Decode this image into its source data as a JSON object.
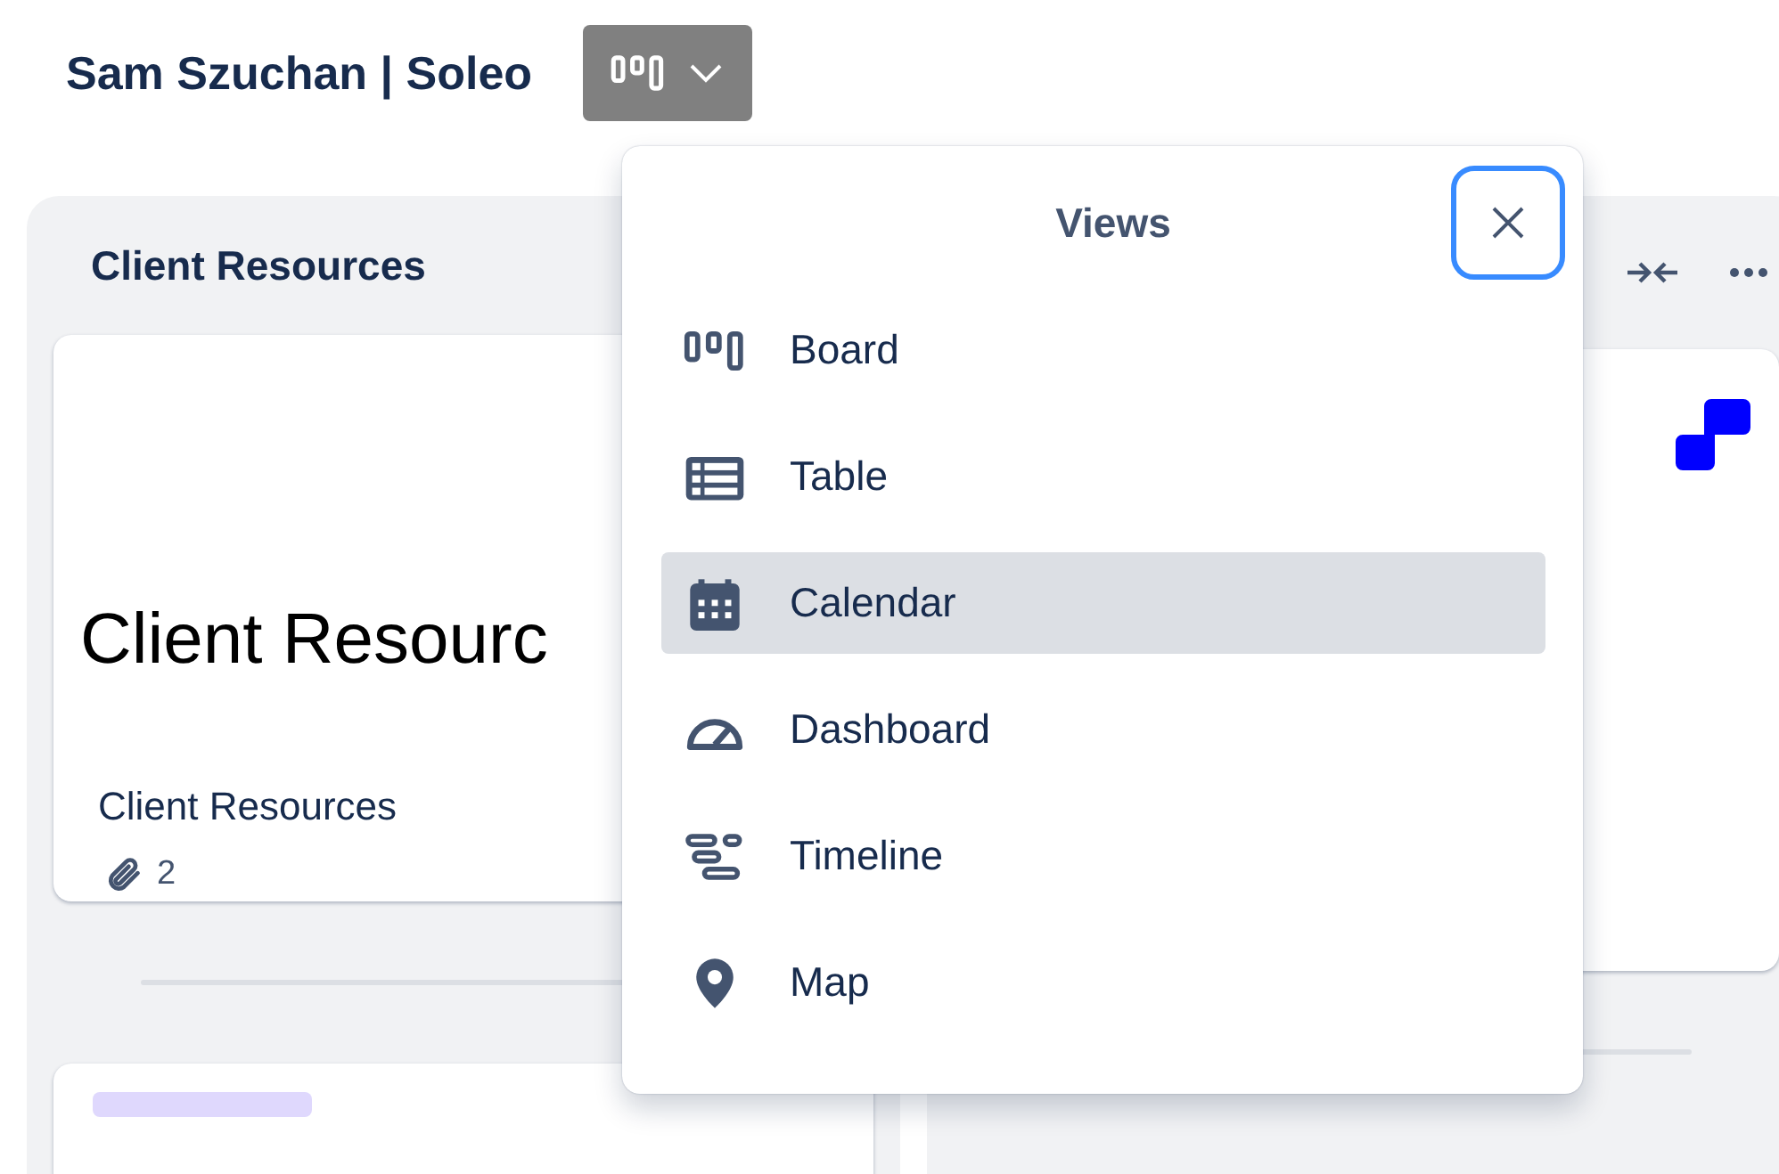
{
  "header": {
    "title": "Sam Szuchan | Soleo"
  },
  "lists": [
    {
      "title": "Client Resources",
      "cards": [
        {
          "kind": "cover",
          "cover_text": "Client Resourc",
          "title": "Client Resources",
          "attachments": "2"
        },
        {
          "kind": "label"
        }
      ]
    },
    {
      "cards": [
        {
          "kind": "logo"
        }
      ]
    }
  ],
  "views_menu": {
    "title": "Views",
    "items": [
      {
        "kind": "board",
        "label": "Board",
        "selected": false
      },
      {
        "kind": "table",
        "label": "Table",
        "selected": false
      },
      {
        "kind": "calendar",
        "label": "Calendar",
        "selected": true
      },
      {
        "kind": "dashboard",
        "label": "Dashboard",
        "selected": false
      },
      {
        "kind": "timeline",
        "label": "Timeline",
        "selected": false
      },
      {
        "kind": "map",
        "label": "Map",
        "selected": false
      }
    ]
  }
}
